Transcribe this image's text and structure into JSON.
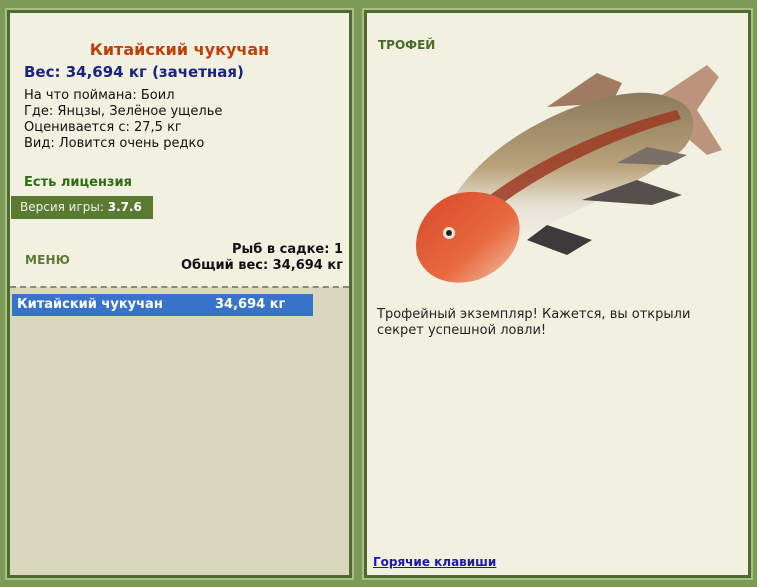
{
  "fish": {
    "name": "Китайский чукучан",
    "weight_line": "Вес: 34,694 кг (зачетная)",
    "bait_line": "На что поймана: Боил",
    "where_line": "Где: Янцзы, Зелёное ущелье",
    "rated_line": "Оценивается с: 27,5 кг",
    "kind_line": "Вид: Ловится очень редко"
  },
  "license": "Есть лицензия",
  "version": {
    "label": "Версия игры:",
    "value": "3.7.6"
  },
  "menu_label": "МЕНЮ",
  "keepnet": {
    "count_line": "Рыб в садке: 1",
    "total_line": "Общий вес: 34,694 кг"
  },
  "catch_list": [
    {
      "name": "Китайский чукучан",
      "weight": "34,694 кг"
    }
  ],
  "trophy": {
    "label": "ТРОФЕЙ",
    "text": "Трофейный экземпляр! Кажется, вы открыли секрет успешной ловли!"
  },
  "hotkeys_label": "Горячие клавиши",
  "colors": {
    "accent_green": "#5a7a33",
    "title_orange": "#c0400c",
    "weight_navy": "#1a237e",
    "selection_blue": "#3773c9",
    "panel_bg": "#f2f1e1"
  }
}
